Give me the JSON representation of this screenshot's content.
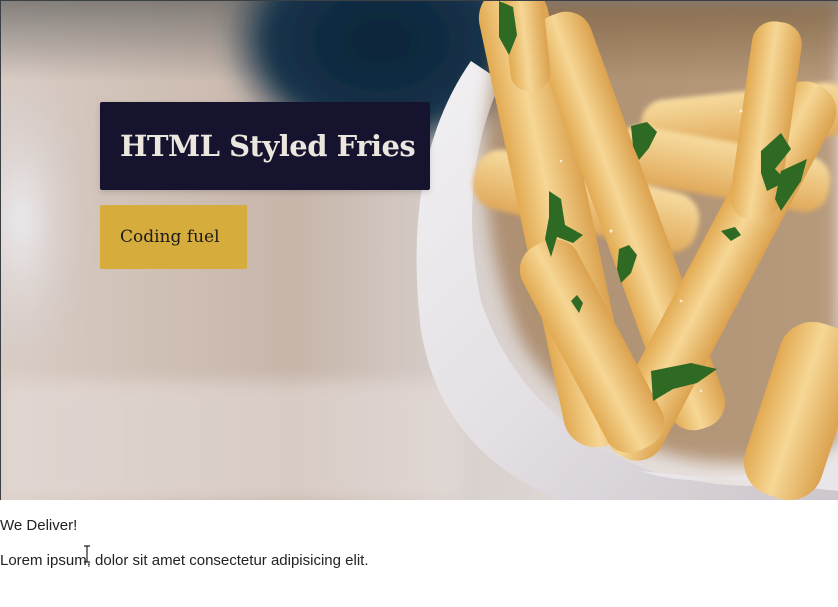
{
  "hero": {
    "title": "HTML Styled Fries",
    "button_label": "Coding fuel"
  },
  "content": {
    "heading": "We Deliver!",
    "body": "Lorem ipsum, dolor sit amet consectetur adipisicing elit."
  },
  "colors": {
    "title_background": "#16132f",
    "button_background": "#d6ad3c",
    "title_text": "#ebe6de"
  }
}
